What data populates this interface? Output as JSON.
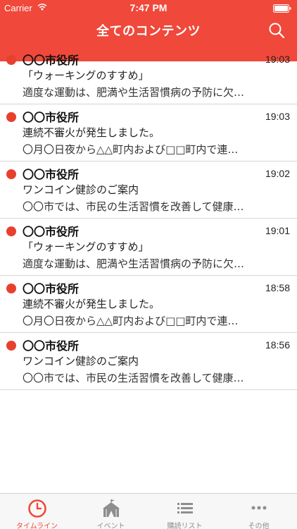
{
  "status_bar": {
    "carrier": "Carrier",
    "time": "7:47 PM"
  },
  "nav": {
    "title": "全てのコンテンツ"
  },
  "colors": {
    "accent": "#f0483a",
    "unread_dot": "#e8402f"
  },
  "items": [
    {
      "sender": "〇〇市役所",
      "time": "19:03",
      "subject": "「ウォーキングのすすめ」",
      "preview": "適度な運動は、肥満や生活習慣病の予防に欠…"
    },
    {
      "sender": "〇〇市役所",
      "time": "19:03",
      "subject": "連続不審火が発生しました。",
      "preview": "〇月〇日夜から△△町内および□□町内で連…"
    },
    {
      "sender": "〇〇市役所",
      "time": "19:02",
      "subject": "ワンコイン健診のご案内",
      "preview": "〇〇市では、市民の生活習慣を改善して健康…"
    },
    {
      "sender": "〇〇市役所",
      "time": "19:01",
      "subject": "「ウォーキングのすすめ」",
      "preview": "適度な運動は、肥満や生活習慣病の予防に欠…"
    },
    {
      "sender": "〇〇市役所",
      "time": "18:58",
      "subject": "連続不審火が発生しました。",
      "preview": "〇月〇日夜から△△町内および□□町内で連…"
    },
    {
      "sender": "〇〇市役所",
      "time": "18:56",
      "subject": "ワンコイン健診のご案内",
      "preview": "〇〇市では、市民の生活習慣を改善して健康…"
    }
  ],
  "tabs": [
    {
      "label": "タイムライン",
      "icon": "clock-icon",
      "active": true
    },
    {
      "label": "イベント",
      "icon": "tent-icon",
      "active": false
    },
    {
      "label": "購読リスト",
      "icon": "list-icon",
      "active": false
    },
    {
      "label": "その他",
      "icon": "more-icon",
      "active": false
    }
  ]
}
